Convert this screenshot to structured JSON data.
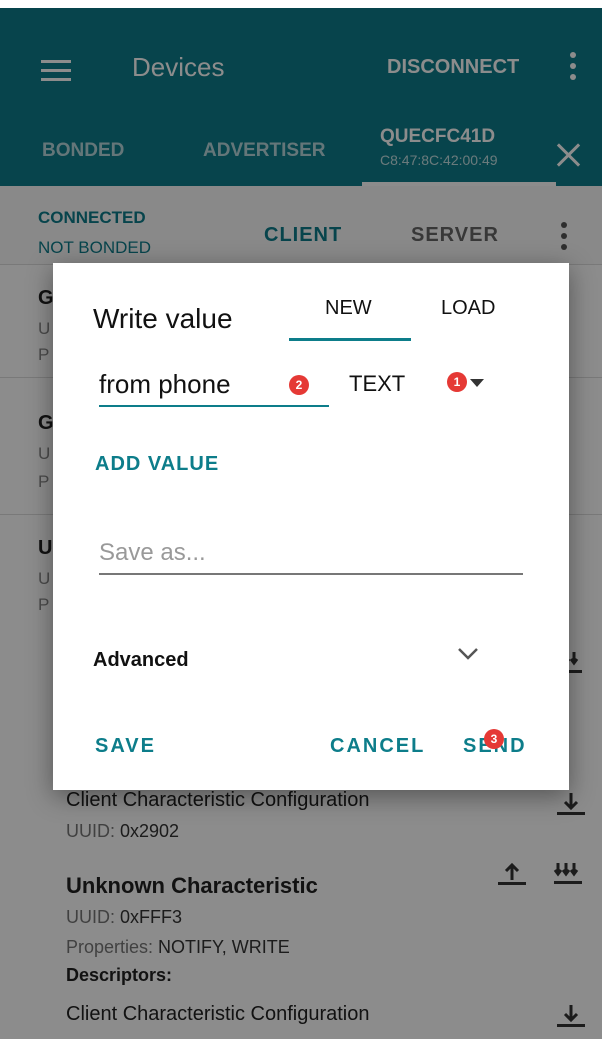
{
  "appbar": {
    "title": "Devices",
    "disconnect_label": "DISCONNECT",
    "colors": {
      "primary": "#0d7d8a",
      "text": "#ffffff"
    }
  },
  "tabs": {
    "bonded": "BONDED",
    "advertiser": "ADVERTISER",
    "device_name": "QUECFC41D",
    "device_address": "C8:47:8C:42:00:49"
  },
  "connection": {
    "status": "CONNECTED",
    "bond": "NOT BONDED",
    "client_tab": "CLIENT",
    "server_tab": "SERVER"
  },
  "services": [
    {
      "letter": "G",
      "sub1": "U",
      "sub2": "P"
    },
    {
      "letter": "G",
      "sub1": "U",
      "sub2": "P"
    },
    {
      "letter": "U",
      "sub1": "U",
      "sub2": "P"
    }
  ],
  "list": {
    "descriptor1_name": "Client Characteristic Configuration",
    "descriptor1_uuid_label": "UUID: ",
    "descriptor1_uuid": "0x2902",
    "char_name": "Unknown Characteristic",
    "char_uuid_label": "UUID: ",
    "char_uuid": "0xFFF3",
    "char_props_label": "Properties: ",
    "char_props": "NOTIFY, WRITE",
    "descriptors_heading": "Descriptors:",
    "descriptor2_name": "Client Characteristic Configuration"
  },
  "dialog": {
    "title": "Write value",
    "tab_new": "NEW",
    "tab_load": "LOAD",
    "value": "from phone",
    "type": "TEXT",
    "add_value": "ADD VALUE",
    "save_as_placeholder": "Save as...",
    "advanced": "Advanced",
    "save": "SAVE",
    "cancel": "CANCEL",
    "send": "SEND",
    "badges": {
      "type": "1",
      "value": "2",
      "send": "3"
    },
    "accent": "#0d7d8a",
    "badge_color": "#e53935"
  }
}
